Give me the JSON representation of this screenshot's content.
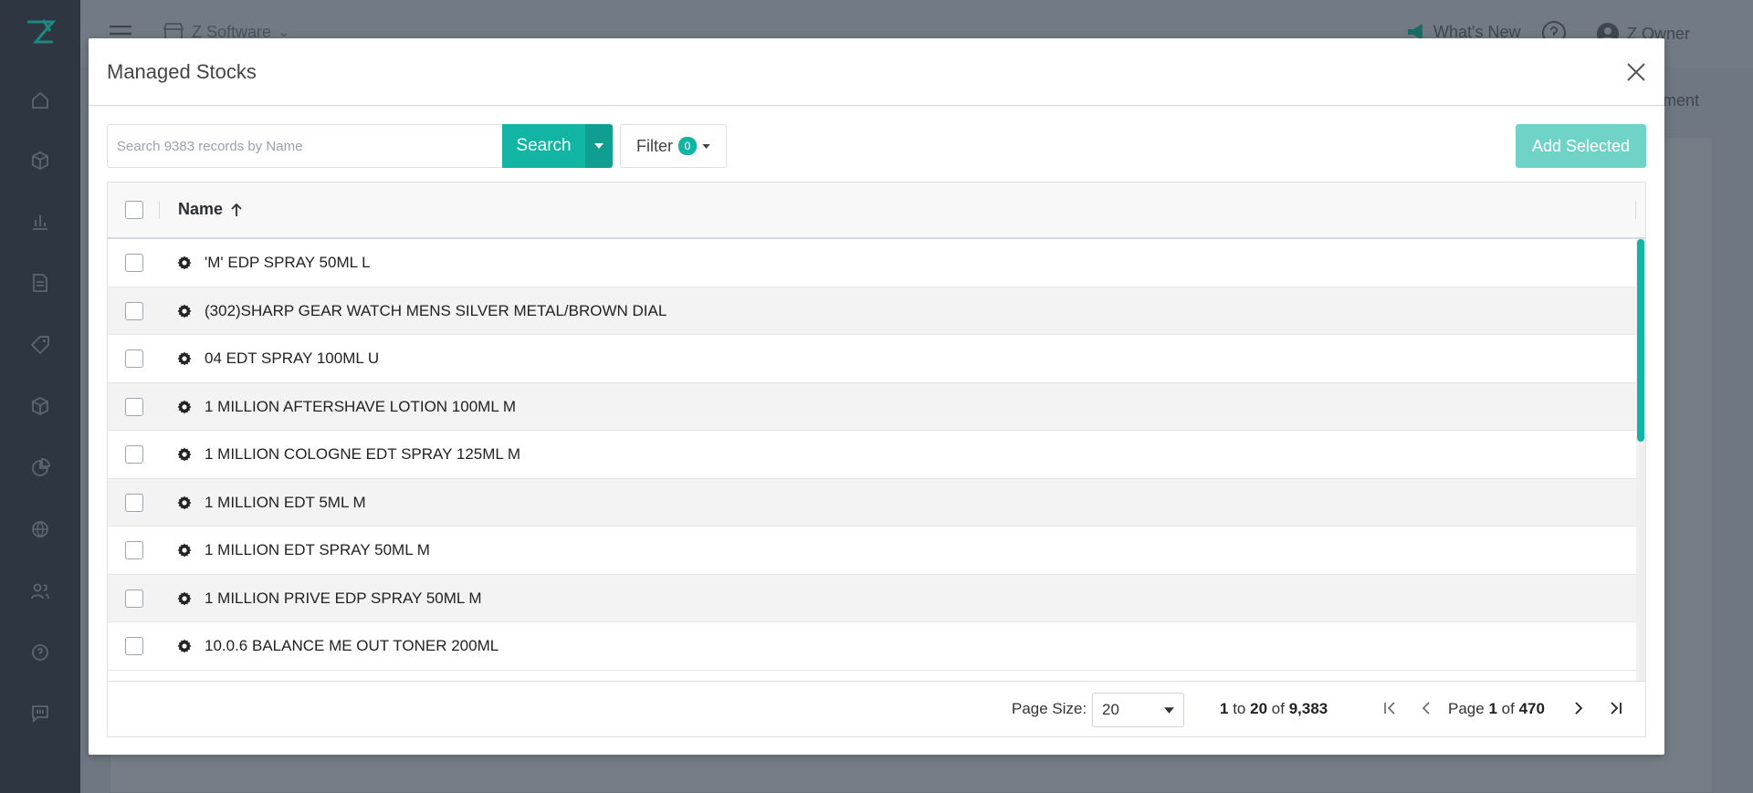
{
  "background": {
    "store_name": "Z Software",
    "whats_new": "What's New",
    "user_name": "Z Owner",
    "department_partial": "rtment"
  },
  "modal": {
    "title": "Managed Stocks",
    "search": {
      "placeholder": "Search 9383 records by Name",
      "button_label": "Search"
    },
    "filter": {
      "label": "Filter",
      "count": "0"
    },
    "add_selected_label": "Add Selected",
    "grid": {
      "column_header": "Name",
      "rows": [
        "'M' EDP SPRAY 50ML L",
        "(302)SHARP GEAR WATCH MENS SILVER METAL/BROWN DIAL",
        "04 EDT SPRAY 100ML U",
        "1 MILLION AFTERSHAVE LOTION 100ML M",
        "1 MILLION COLOGNE EDT SPRAY 125ML M",
        "1 MILLION EDT 5ML M",
        "1 MILLION EDT SPRAY 50ML M",
        "1 MILLION PRIVE EDP SPRAY 50ML M",
        "10.0.6 BALANCE ME OUT TONER 200ML"
      ]
    },
    "pager": {
      "page_size_label": "Page Size:",
      "page_size_value": "20",
      "range_from": "1",
      "range_to_word": "to",
      "range_to": "20",
      "range_of_word": "of",
      "range_total": "9,383",
      "page_word": "Page",
      "page_current": "1",
      "page_of_word": "of",
      "page_total": "470"
    }
  },
  "colors": {
    "accent": "#12b5a4",
    "accent_dark": "#0f9e90",
    "accent_light": "#6fd3c8",
    "sidebar": "#2d3641"
  }
}
